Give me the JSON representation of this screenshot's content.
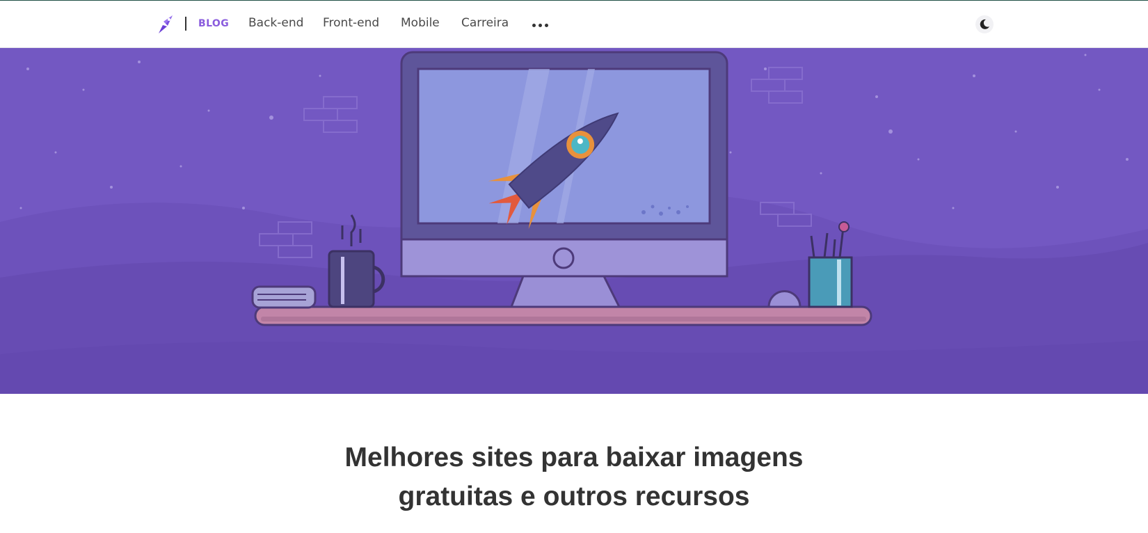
{
  "header": {
    "logo_icon": "rocket-icon",
    "section_label": "BLOG",
    "nav": [
      {
        "label": "Back-end"
      },
      {
        "label": "Front-end"
      },
      {
        "label": "Mobile"
      },
      {
        "label": "Carreira"
      }
    ],
    "more_icon": "more-dots-icon",
    "theme_toggle_icon": "moon-icon"
  },
  "hero": {
    "illustration": "desk-computer-rocket-illustration",
    "background_color": "#7358c2"
  },
  "article": {
    "title": "Melhores sites para baixar imagens gratuitas e outros recursos"
  },
  "colors": {
    "accent": "#8a5cdd",
    "hero": "#7358c2",
    "text": "#333333"
  }
}
